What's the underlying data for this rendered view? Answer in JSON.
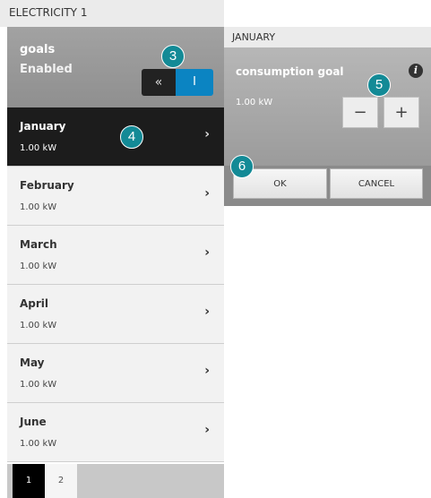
{
  "window": {
    "title": "ELECTRICITY 1"
  },
  "goals": {
    "label": "goals",
    "state": "Enabled",
    "toggle": {
      "off_symbol": "«",
      "on_symbol": "I"
    }
  },
  "months": [
    {
      "name": "January",
      "value": "1.00 kW",
      "chevron": "›"
    },
    {
      "name": "February",
      "value": "1.00 kW",
      "chevron": "›"
    },
    {
      "name": "March",
      "value": "1.00 kW",
      "chevron": "›"
    },
    {
      "name": "April",
      "value": "1.00 kW",
      "chevron": "›"
    },
    {
      "name": "May",
      "value": "1.00 kW",
      "chevron": "›"
    },
    {
      "name": "June",
      "value": "1.00 kW",
      "chevron": "›"
    }
  ],
  "pager": {
    "pages": [
      "1",
      "2"
    ]
  },
  "popup": {
    "title": "JANUARY",
    "label": "consumption goal",
    "value": "1.00 kW",
    "info_symbol": "i",
    "minus_symbol": "−",
    "plus_symbol": "+",
    "ok_label": "OK",
    "cancel_label": "CANCEL"
  },
  "callouts": {
    "c3": "3",
    "c4": "4",
    "c5": "5",
    "c6": "6"
  },
  "colors": {
    "accent": "#0b84c2",
    "callout": "#138a96",
    "active_row": "#1c1c1c"
  }
}
